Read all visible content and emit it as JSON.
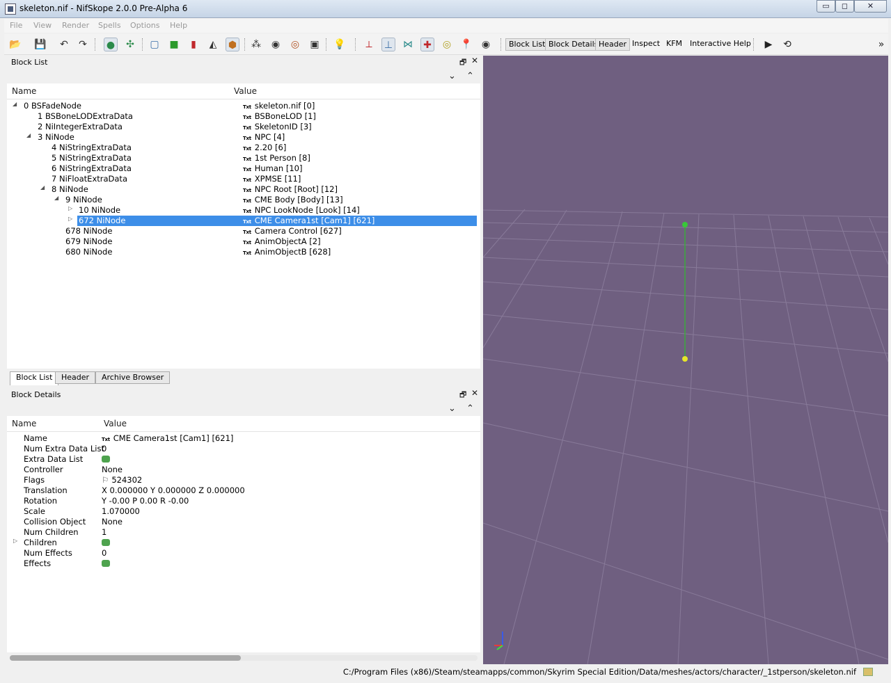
{
  "window": {
    "title": "skeleton.nif - NifSkope 2.0.0 Pre-Alpha 6",
    "minimize": "▭",
    "maximize": "◻",
    "close": "✕"
  },
  "menu": [
    "File",
    "View",
    "Render",
    "Spells",
    "Options",
    "Help"
  ],
  "toolbar": {
    "buttons": [
      "Block List",
      "Block Details",
      "Header",
      "Inspect",
      "KFM",
      "Interactive Help"
    ],
    "play": "▶",
    "loop": "⟲",
    "overflow": "»"
  },
  "block_list": {
    "title": "Block List",
    "columns": {
      "name": "Name",
      "value": "Value"
    },
    "rows": [
      {
        "name": "0 BSFadeNode",
        "value": "skeleton.nif [0]"
      },
      {
        "name": "1 BSBoneLODExtraData",
        "value": "BSBoneLOD [1]"
      },
      {
        "name": "2 NiIntegerExtraData",
        "value": "SkeletonID [3]"
      },
      {
        "name": "3 NiNode",
        "value": "NPC [4]"
      },
      {
        "name": "4 NiStringExtraData",
        "value": "2.20 [6]"
      },
      {
        "name": "5 NiStringExtraData",
        "value": "1st Person [8]"
      },
      {
        "name": "6 NiStringExtraData",
        "value": "Human [10]"
      },
      {
        "name": "7 NiFloatExtraData",
        "value": "XPMSE [11]"
      },
      {
        "name": "8 NiNode",
        "value": "NPC Root [Root] [12]"
      },
      {
        "name": "9 NiNode",
        "value": "CME Body [Body] [13]"
      },
      {
        "name": "10 NiNode",
        "value": "NPC LookNode [Look] [14]"
      },
      {
        "name": "672 NiNode",
        "value": "CME Camera1st [Cam1] [621]"
      },
      {
        "name": "678 NiNode",
        "value": "Camera Control [627]"
      },
      {
        "name": "679 NiNode",
        "value": "AnimObjectA [2]"
      },
      {
        "name": "680 NiNode",
        "value": "AnimObjectB [628]"
      }
    ],
    "txt_badge": "Txt"
  },
  "tabs": [
    "Block List",
    "Header",
    "Archive Browser"
  ],
  "block_details": {
    "title": "Block Details",
    "columns": {
      "name": "Name",
      "value": "Value"
    },
    "rows": [
      {
        "name": "Name",
        "value": "CME Camera1st [Cam1] [621]"
      },
      {
        "name": "Num Extra Data List",
        "value": "0"
      },
      {
        "name": "Extra Data List",
        "value": ""
      },
      {
        "name": "Controller",
        "value": "None"
      },
      {
        "name": "Flags",
        "value": "524302"
      },
      {
        "name": "Translation",
        "value": "X 0.000000 Y 0.000000 Z 0.000000"
      },
      {
        "name": "Rotation",
        "value": "Y -0.00 P 0.00 R -0.00"
      },
      {
        "name": "Scale",
        "value": "1.070000"
      },
      {
        "name": "Collision Object",
        "value": "None"
      },
      {
        "name": "Num Children",
        "value": "1"
      },
      {
        "name": "Children",
        "value": ""
      },
      {
        "name": "Num Effects",
        "value": "0"
      },
      {
        "name": "Effects",
        "value": ""
      }
    ]
  },
  "status": {
    "path": "C:/Program Files (x86)/Steam/steamapps/common/Skyrim Special Edition/Data/meshes/actors/character/_1stperson/skeleton.nif"
  }
}
